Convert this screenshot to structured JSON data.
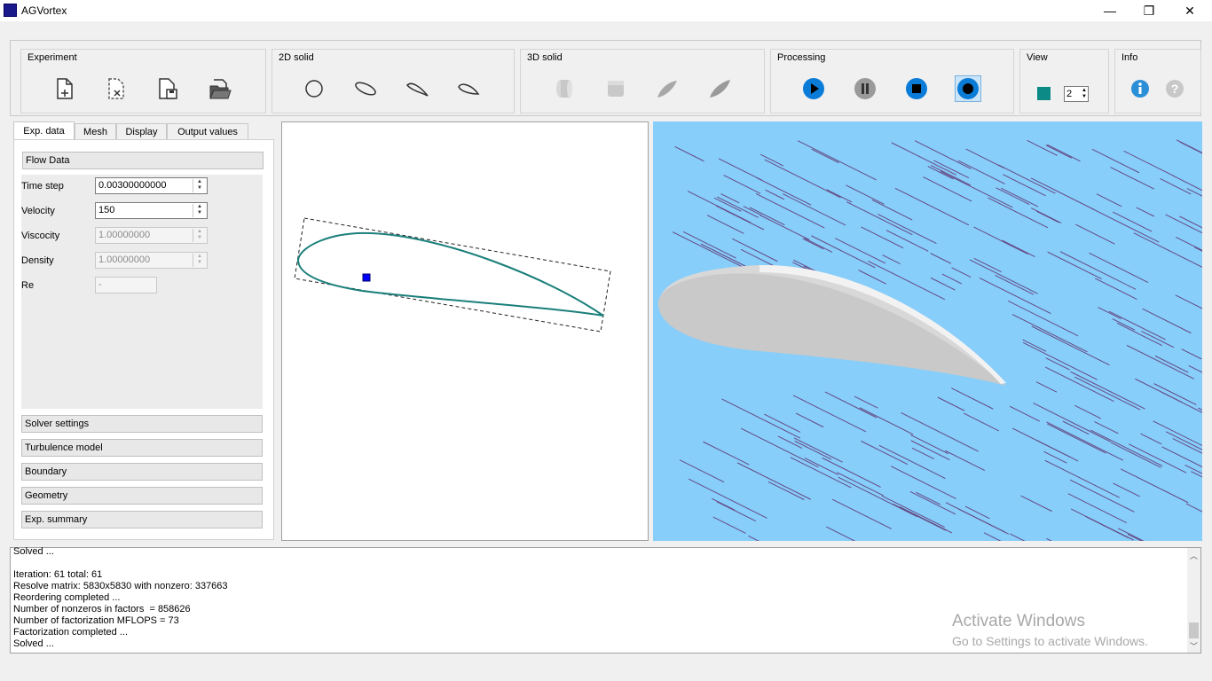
{
  "window": {
    "title": "AGVortex",
    "min": "—",
    "max": "❐",
    "close": "✕"
  },
  "ribbon": {
    "groups": [
      {
        "title": "Experiment",
        "buttons": [
          "new-file-icon",
          "close-file-icon",
          "save-file-icon",
          "open-folder-icon"
        ]
      },
      {
        "title": "2D solid",
        "buttons": [
          "circle-icon",
          "ellipse-icon",
          "airfoil-icon",
          "wing-icon"
        ]
      },
      {
        "title": "3D solid",
        "buttons": [
          "cylinder-icon",
          "box-icon",
          "blade-icon",
          "leaf-wing-icon"
        ]
      },
      {
        "title": "Processing",
        "buttons": [
          "play-icon",
          "pause-icon",
          "stop-icon",
          "record-icon"
        ]
      },
      {
        "title": "View",
        "spin_value": "2"
      },
      {
        "title": "Info",
        "buttons": [
          "info-icon",
          "help-icon"
        ]
      }
    ]
  },
  "tabs": [
    "Exp. data",
    "Mesh",
    "Display",
    "Output values"
  ],
  "flow": {
    "header": "Flow Data",
    "fields": [
      {
        "label": "Time step",
        "value": "0.00300000000",
        "enabled": true
      },
      {
        "label": "Velocity",
        "value": "150",
        "enabled": true
      },
      {
        "label": "Viscocity",
        "value": "1.00000000",
        "enabled": false
      },
      {
        "label": "Density",
        "value": "1.00000000",
        "enabled": false
      },
      {
        "label": "Re",
        "value": "-",
        "enabled": false
      }
    ]
  },
  "sections": [
    "Solver settings",
    "Turbulence model",
    "Boundary",
    "Geometry",
    "Exp. summary"
  ],
  "log": [
    "Solved ...",
    "",
    "Iteration: 61 total: 61",
    "Resolve matrix: 5830x5830 with nonzero: 337663",
    "Reordering completed ...",
    "Number of nonzeros in factors  = 858626",
    "Number of factorization MFLOPS = 73",
    "Factorization completed ...",
    "Solved ..."
  ],
  "watermark": {
    "line1": "Activate Windows",
    "line2": "Go to Settings to activate Windows."
  },
  "colors": {
    "airfoil": "#1a7f7a",
    "flow_bg": "#87cefa",
    "streamline": "#5a1e5e",
    "accent": "#0078d7"
  }
}
